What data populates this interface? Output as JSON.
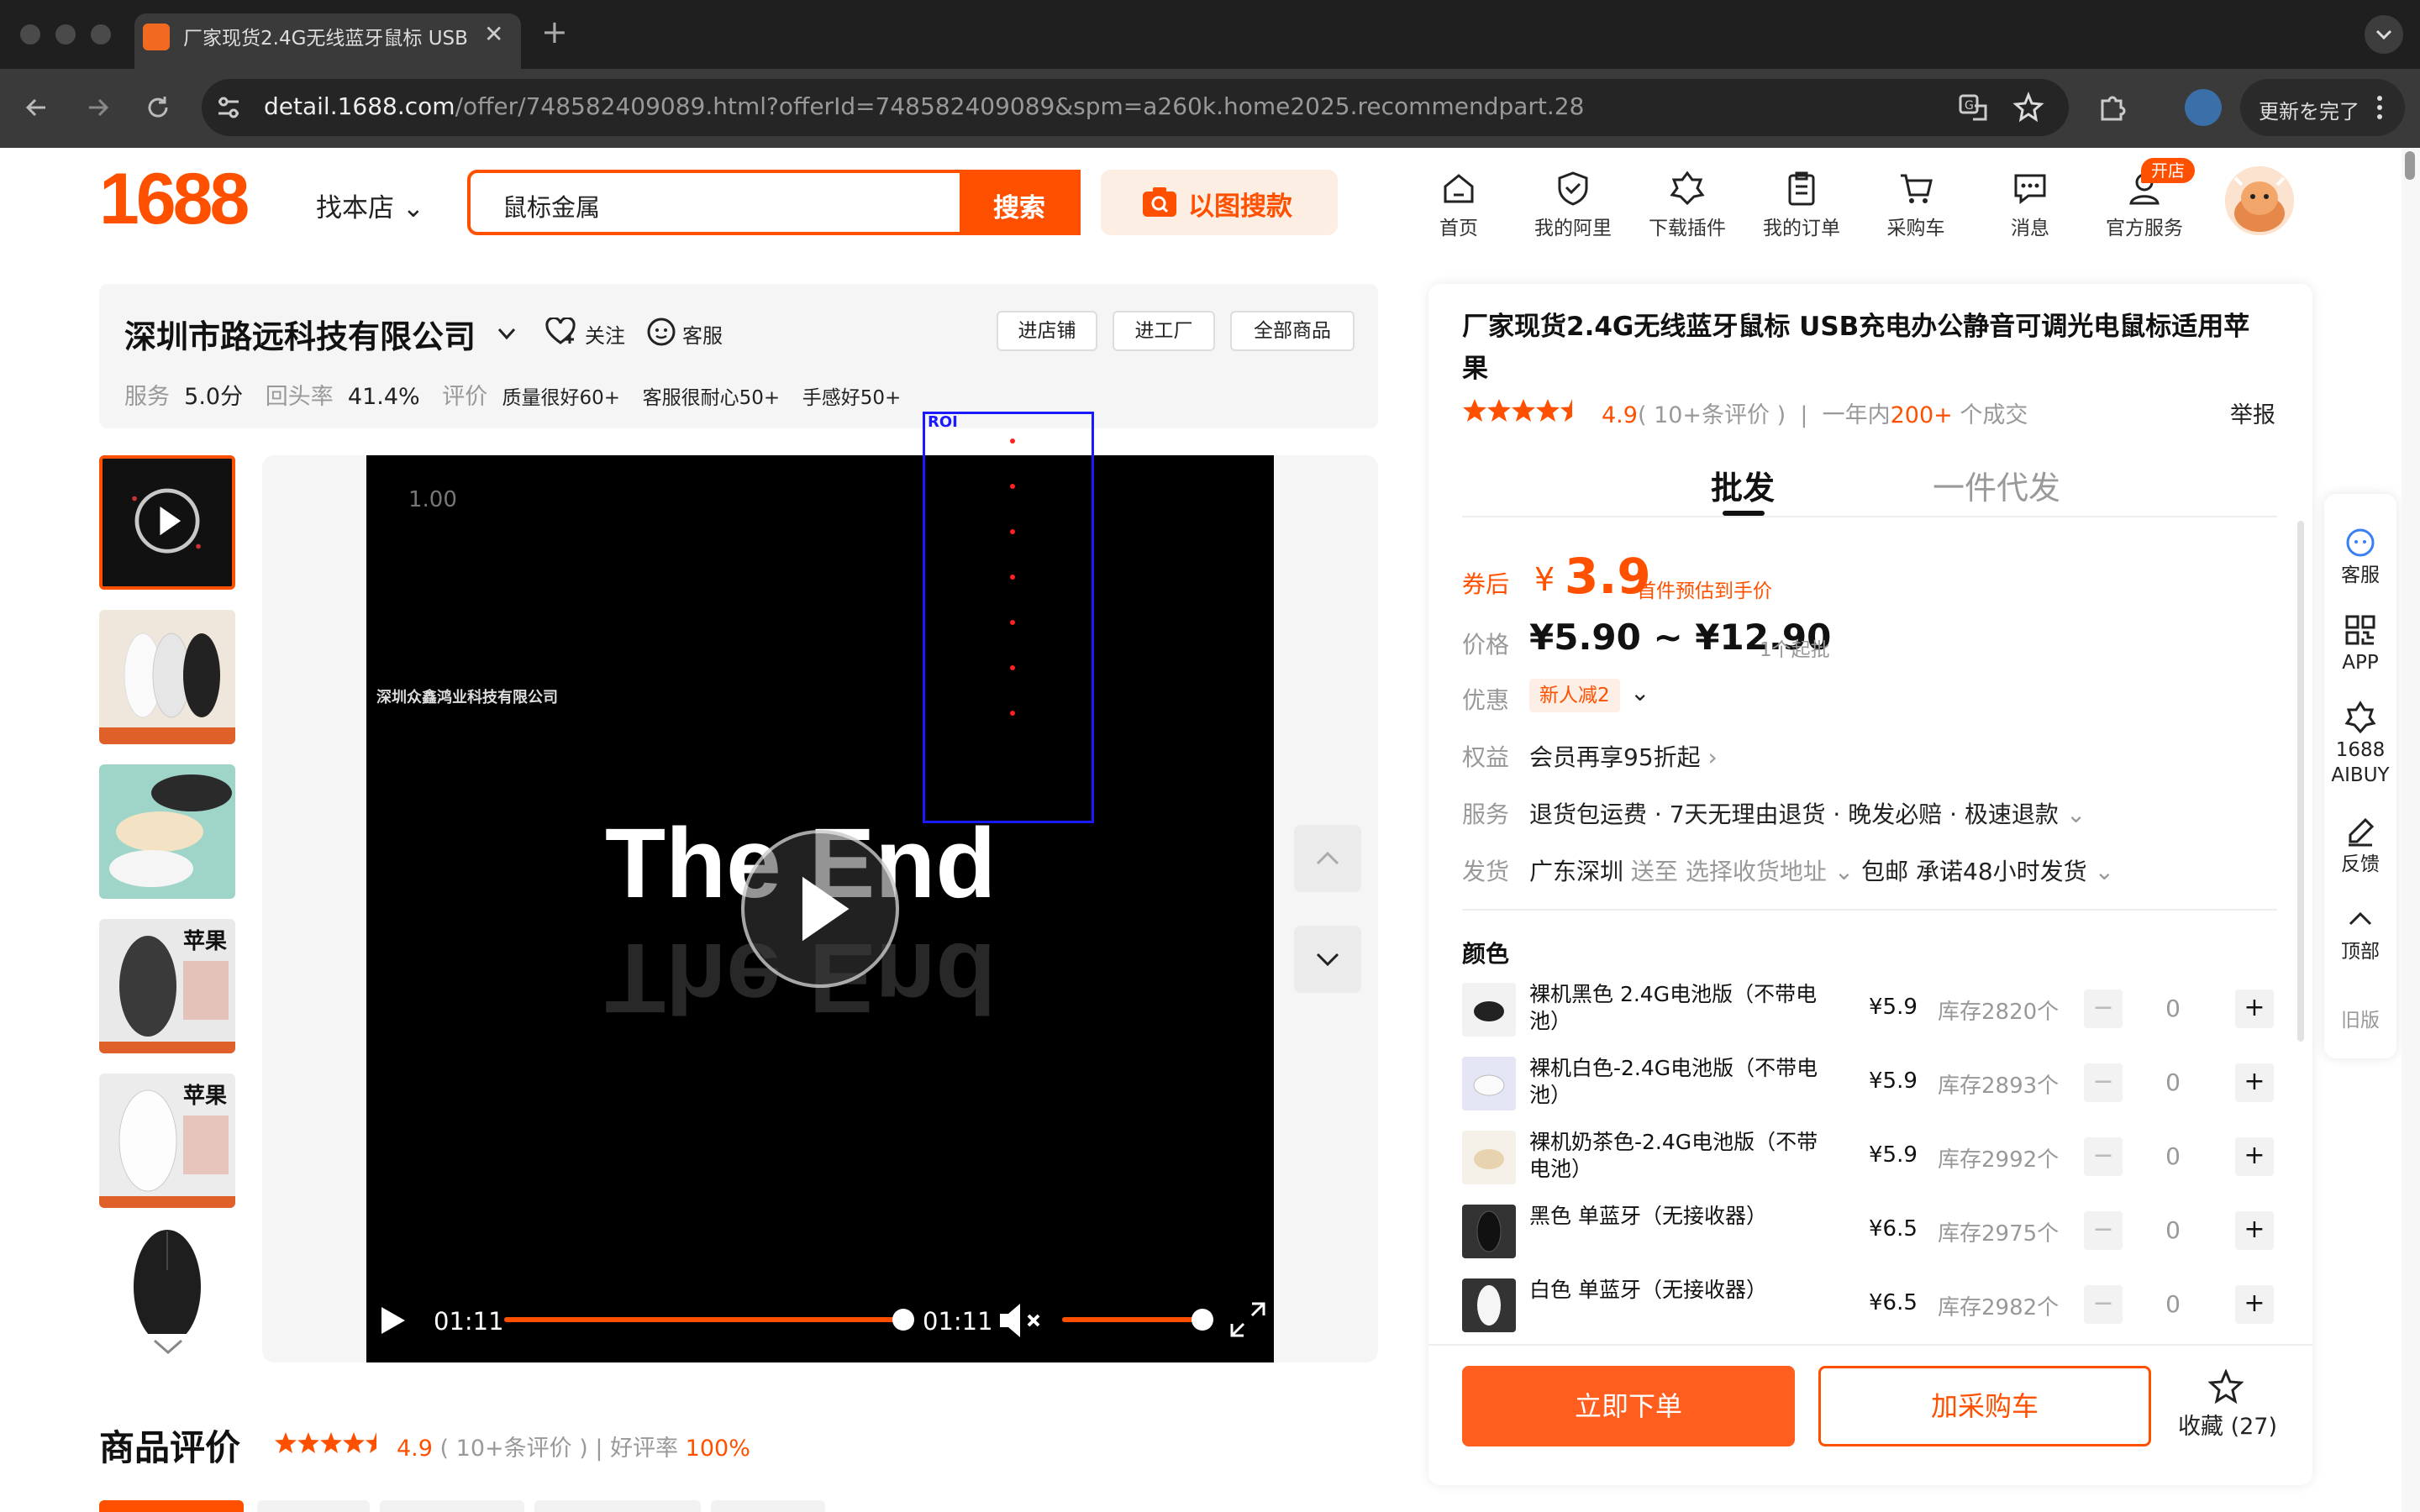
{
  "browser": {
    "tab_title": "厂家现货2.4G无线蓝牙鼠标 USB",
    "url_host": "detail.1688.com",
    "url_path": "/offer/748582409089.html?offerId=748582409089&spm=a260k.home2025.recommendpart.28",
    "update_label": "更新を完了"
  },
  "header": {
    "logo": "1688",
    "find_shop": "找本店",
    "search_value": "鼠标金属",
    "search_label": "搜索",
    "image_search_label": "以图搜款",
    "nav": [
      "首页",
      "我的阿里",
      "下载插件",
      "我的订单",
      "采购车",
      "消息",
      "官方服务"
    ],
    "open_badge": "开店"
  },
  "shop": {
    "name": "深圳市路远科技有限公司",
    "follow": "关注",
    "service": "客服",
    "buttons": [
      "进店铺",
      "进工厂",
      "全部商品"
    ],
    "stats": {
      "service_k": "服务",
      "service_v": "5.0分",
      "repurchase_k": "回头率",
      "repurchase_v": "41.4%",
      "review_k": "评价",
      "tags": [
        "质量很好60+",
        "客服很耐心50+",
        "手感好50+"
      ]
    }
  },
  "video": {
    "corner_value": "1.00",
    "company": "深圳众鑫鸿业科技有限公司",
    "caption": "The End",
    "time_current": "01:11",
    "time_duration": "01:11",
    "progress": 1.0,
    "volume": 1.0,
    "roi_label": "ROI"
  },
  "thumbnails": [
    {
      "name": "video-cover",
      "label": ""
    },
    {
      "name": "mouse-white-black",
      "label": ""
    },
    {
      "name": "mouse-pastel",
      "label": ""
    },
    {
      "name": "mouse-apple-black",
      "label": "苹果"
    },
    {
      "name": "mouse-apple-white",
      "label": "苹果"
    },
    {
      "name": "mouse-black-top",
      "label": ""
    }
  ],
  "reviews": {
    "title": "商品评价",
    "score": "4.9",
    "count_text": "( 10+条评价 )",
    "sep": "|",
    "good_rate_label": "好评率",
    "good_rate_value": "100%"
  },
  "product": {
    "title": "厂家现货2.4G无线蓝牙鼠标 USB充电办公静音可调光电鼠标适用苹果",
    "rating": "4.9",
    "rating_count": "( 10+条评价 )",
    "sales_prefix": "一年内",
    "sales_value": "200+",
    "sales_suffix": "个成交",
    "report": "举报",
    "tab_wholesale": "批发",
    "tab_dropship": "一件代发",
    "coupon_label": "券后",
    "coupon_currency": "¥",
    "coupon_value": "3.9",
    "coupon_note": "首件预估到手价",
    "price_label": "价格",
    "price_range": "¥5.90 ~ ¥12.90",
    "price_min_order": "1个起批",
    "promo_label": "优惠",
    "promo_tag": "新人减2",
    "benefit_label": "权益",
    "benefit_value": "会员再享95折起",
    "service_label": "服务",
    "service_value": "退货包运费 · 7天无理由退货 · 晚发必赔 · 极速退款",
    "ship_label": "发货",
    "ship_from": "广东深圳",
    "ship_to_prefix": "送至",
    "ship_to": "选择收货地址",
    "ship_free": "包邮",
    "ship_promise": "承诺48小时发货",
    "color_label": "颜色",
    "skus": [
      {
        "name": "裸机黑色 2.4G电池版（不带电池）",
        "price": "¥5.9",
        "stock": "库存2820个",
        "qty": "0"
      },
      {
        "name": "裸机白色-2.4G电池版（不带电池）",
        "price": "¥5.9",
        "stock": "库存2893个",
        "qty": "0"
      },
      {
        "name": "裸机奶茶色-2.4G电池版（不带电池）",
        "price": "¥5.9",
        "stock": "库存2992个",
        "qty": "0"
      },
      {
        "name": "黑色 单蓝牙（无接收器）",
        "price": "¥6.5",
        "stock": "库存2975个",
        "qty": "0"
      },
      {
        "name": "白色 单蓝牙（无接收器）",
        "price": "¥6.5",
        "stock": "库存2982个",
        "qty": "0"
      }
    ],
    "buy_now": "立即下单",
    "add_cart": "加采购车",
    "favorite": "收藏 (27)"
  },
  "sidebar": {
    "items": [
      "客服",
      "APP",
      "1688 AIBUY",
      "反馈",
      "顶部",
      "旧版"
    ]
  },
  "colors": {
    "brand": "#ff5000",
    "roi": "#1a1aff"
  }
}
